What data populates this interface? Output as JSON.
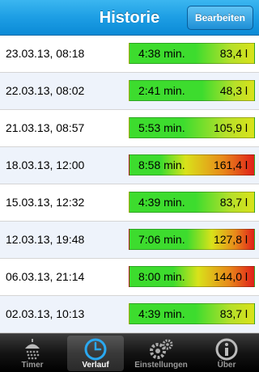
{
  "header": {
    "title": "Historie",
    "edit_label": "Bearbeiten"
  },
  "entries": [
    {
      "date": "23.03.13, 08:18",
      "duration": "4:38 min.",
      "volume": "83,4 l",
      "level": 0.18
    },
    {
      "date": "22.03.13, 08:02",
      "duration": "2:41 min.",
      "volume": "48,3 l",
      "level": 0.05
    },
    {
      "date": "21.03.13, 08:57",
      "duration": "5:53 min.",
      "volume": "105,9 l",
      "level": 0.42
    },
    {
      "date": "18.03.13, 12:00",
      "duration": "8:58 min.",
      "volume": "161,4 l",
      "level": 1.0
    },
    {
      "date": "15.03.13, 12:32",
      "duration": "4:39 min.",
      "volume": "83,7 l",
      "level": 0.18
    },
    {
      "date": "12.03.13, 19:48",
      "duration": "7:06 min.",
      "volume": "127,8 l",
      "level": 0.62
    },
    {
      "date": "06.03.13, 21:14",
      "duration": "8:00 min.",
      "volume": "144,0 l",
      "level": 0.82
    },
    {
      "date": "02.03.13, 10:13",
      "duration": "4:39 min.",
      "volume": "83,7 l",
      "level": 0.18
    },
    {
      "date": "",
      "duration": "",
      "volume": "",
      "level": 0.3
    }
  ],
  "tabs": [
    {
      "label": "Timer",
      "icon": "shower-icon",
      "active": false
    },
    {
      "label": "Verlauf",
      "icon": "clock-icon",
      "active": true
    },
    {
      "label": "Einstellungen",
      "icon": "gears-icon",
      "active": false
    },
    {
      "label": "Über",
      "icon": "info-icon",
      "active": false
    }
  ],
  "colors": {
    "navbar": "#1d9ee4",
    "bar_green": "#3ddc2e",
    "bar_yellow": "#d9e21a",
    "bar_red": "#e0201a"
  }
}
